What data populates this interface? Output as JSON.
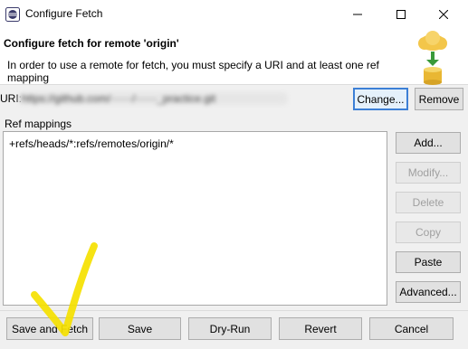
{
  "window": {
    "title": "Configure Fetch",
    "icons": {
      "app": "eclipse-icon",
      "minimize": "minimize-icon",
      "maximize": "maximize-icon",
      "close": "close-icon"
    }
  },
  "header": {
    "title": "Configure fetch for remote 'origin'",
    "description": "In order to use a remote for fetch, you must specify a URI and at least one ref mapping",
    "icon": "remote-repository-icon"
  },
  "uri": {
    "label": "URI:",
    "value": "https://github.com/······/······_practice.git",
    "change_label": "Change...",
    "remove_label": "Remove"
  },
  "ref_mappings": {
    "label": "Ref mappings",
    "items": [
      "+refs/heads/*:refs/remotes/origin/*"
    ],
    "buttons": {
      "add": "Add...",
      "modify": "Modify...",
      "delete": "Delete",
      "copy": "Copy",
      "paste": "Paste",
      "advanced": "Advanced..."
    }
  },
  "footer": {
    "save_and_fetch": "Save and Fetch",
    "save": "Save",
    "dry_run": "Dry-Run",
    "revert": "Revert",
    "cancel": "Cancel"
  },
  "colors": {
    "window_bg": "#f0f0f0",
    "focus_border": "#3c7fd6",
    "annotation": "#f5e100"
  }
}
